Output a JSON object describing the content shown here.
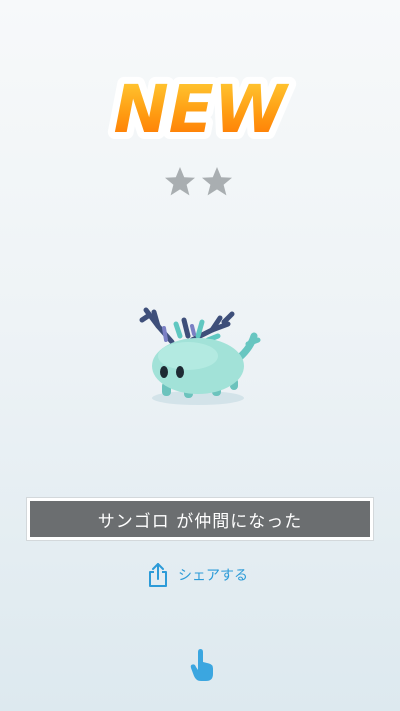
{
  "header": {
    "badge_text": "NEW",
    "rarity_stars": 2,
    "rarity_max_shown": 2
  },
  "creature": {
    "icon": "coral-creature-icon"
  },
  "message": {
    "text": "サンゴロ が仲間になった"
  },
  "share": {
    "label": "シェアする",
    "icon": "share-icon"
  },
  "hint": {
    "icon": "tap-hand-icon"
  },
  "colors": {
    "badge_top": "#ffb21f",
    "badge_bottom": "#ff6f00",
    "star": "#a9aeb1",
    "banner_bg": "#6b6e70",
    "accent": "#2c9bd8",
    "creature_body": "#9fe0d6",
    "antler": "#3e4f7a"
  }
}
